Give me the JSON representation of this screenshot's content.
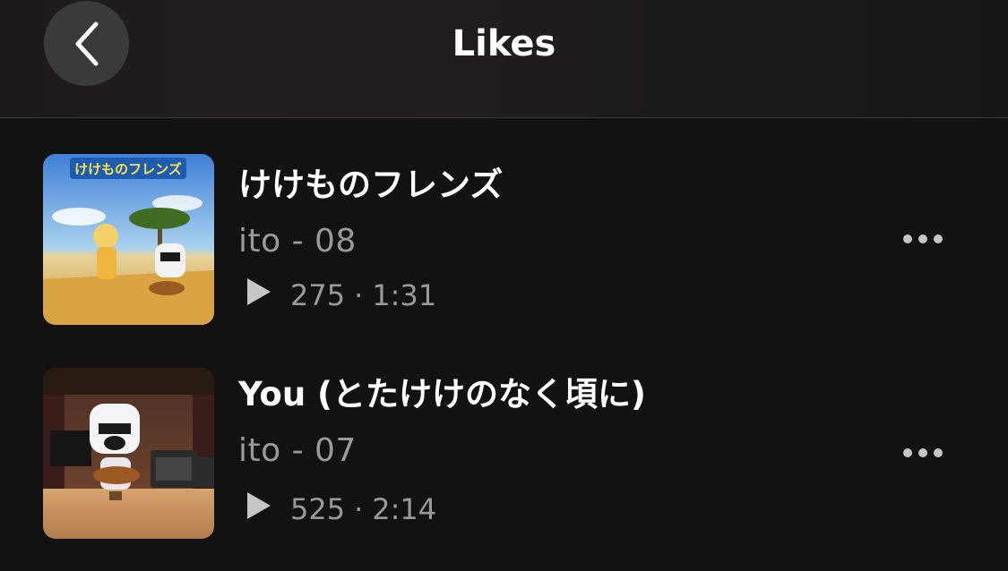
{
  "header": {
    "title": "Likes",
    "back_icon": "chevron-left-icon"
  },
  "tracks": [
    {
      "title": "けけものフレンズ",
      "artist": "ito - 08",
      "plays": "275",
      "separator": "·",
      "duration": "1:31",
      "play_icon": "play-icon",
      "more_icon": "more-horizontal-icon"
    },
    {
      "title": "You (とたけけのなく頃に)",
      "artist": "ito - 07",
      "plays": "525",
      "separator": "·",
      "duration": "2:14",
      "play_icon": "play-icon",
      "more_icon": "more-horizontal-icon"
    }
  ],
  "colors": {
    "background": "#121212",
    "title_text": "#ffffff",
    "secondary_text": "#9a9a9e",
    "back_button_bg": "#3a3a3c",
    "divider": "#3a3a3c"
  }
}
